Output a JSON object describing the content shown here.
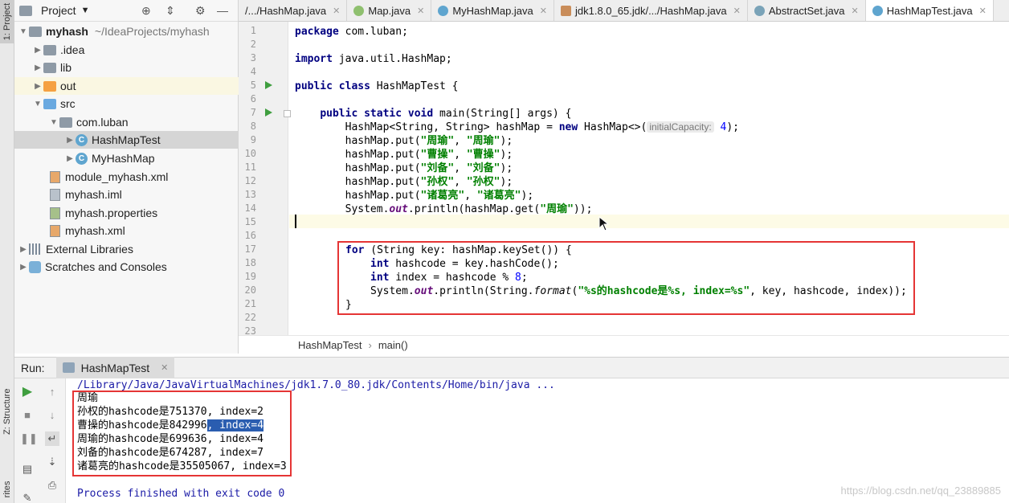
{
  "side_stripe": {
    "project_tab": "1: Project",
    "structure_tab": "Z: Structure",
    "favorites_tab": "rites"
  },
  "project": {
    "title": "Project",
    "tree": [
      {
        "label": "myhash",
        "suffix": "~/IdeaProjects/myhash"
      },
      {
        "label": ".idea"
      },
      {
        "label": "lib"
      },
      {
        "label": "out"
      },
      {
        "label": "src"
      },
      {
        "label": "com.luban"
      },
      {
        "label": "HashMapTest"
      },
      {
        "label": "MyHashMap"
      },
      {
        "label": "module_myhash.xml"
      },
      {
        "label": "myhash.iml"
      },
      {
        "label": "myhash.properties"
      },
      {
        "label": "myhash.xml"
      },
      {
        "label": "External Libraries"
      },
      {
        "label": "Scratches and Consoles"
      }
    ]
  },
  "tabs": [
    "/.../HashMap.java",
    "Map.java",
    "MyHashMap.java",
    "jdk1.8.0_65.jdk/.../HashMap.java",
    "AbstractSet.java",
    "HashMapTest.java"
  ],
  "code": {
    "line_numbers": [
      "1",
      "2",
      "3",
      "4",
      "5",
      "6",
      "7",
      "8",
      "9",
      "10",
      "11",
      "12",
      "13",
      "14",
      "15",
      "16",
      "17",
      "18",
      "19",
      "20",
      "21",
      "22",
      "23"
    ],
    "l1_kw": "package",
    "l1_rest": " com.luban;",
    "l3_kw": "import",
    "l3_rest": " java.util.HashMap;",
    "l5_kw": "public class",
    "l5_rest": " HashMapTest {",
    "l7_pre": "    ",
    "l7_kw": "public static void",
    "l7_rest": " main(String[] args) {",
    "l8_a": "        HashMap<String, String> hashMap = ",
    "l8_kw": "new",
    "l8_b": " HashMap<>(",
    "l8_hint": "initialCapacity:",
    "l8_num": " 4",
    "l8_c": ");",
    "puts": [
      {
        "k": "\"周瑜\"",
        "v": "\"周瑜\""
      },
      {
        "k": "\"曹操\"",
        "v": "\"曹操\""
      },
      {
        "k": "\"刘备\"",
        "v": "\"刘备\""
      },
      {
        "k": "\"孙权\"",
        "v": "\"孙权\""
      },
      {
        "k": "\"诸葛亮\"",
        "v": "\"诸葛亮\""
      }
    ],
    "put_prefix": "        hashMap.put(",
    "put_sep": ", ",
    "put_end": ");",
    "l14_a": "        System.",
    "l14_out": "out",
    "l14_b": ".println(hashMap.get(",
    "l14_str": "\"周瑜\"",
    "l14_c": "));",
    "l17_kw": "for",
    "l17_rest": " (String key: hashMap.keySet()) {",
    "l18_kw": "int",
    "l18_rest": " hashcode = key.hashCode();",
    "l19_kw": "int",
    "l19_rest": " index = hashcode % ",
    "l19_num": "8",
    "l19_end": ";",
    "l20_a": "System.",
    "l20_out": "out",
    "l20_b": ".println(String.",
    "l20_fmt": "format",
    "l20_c": "(",
    "l20_str": "\"%s的hashcode是%s, index=%s\"",
    "l20_d": ", key, hashcode, index));",
    "l21": "}"
  },
  "breadcrumbs": [
    "HashMapTest",
    "main()"
  ],
  "run": {
    "label": "Run:",
    "tab": "HashMapTest",
    "output": [
      "/Library/Java/JavaVirtualMachines/jdk1.7.0_80.jdk/Contents/Home/bin/java ...",
      "周瑜",
      "孙权的hashcode是751370, index=2",
      "曹操的hashcode是842996",
      ", index=4",
      "周瑜的hashcode是699636, index=4",
      "刘备的hashcode是674287, index=7",
      "诸葛亮的hashcode是35505067, index=3",
      "Process finished with exit code 0"
    ]
  },
  "watermark": "https://blog.csdn.net/qq_23889885"
}
